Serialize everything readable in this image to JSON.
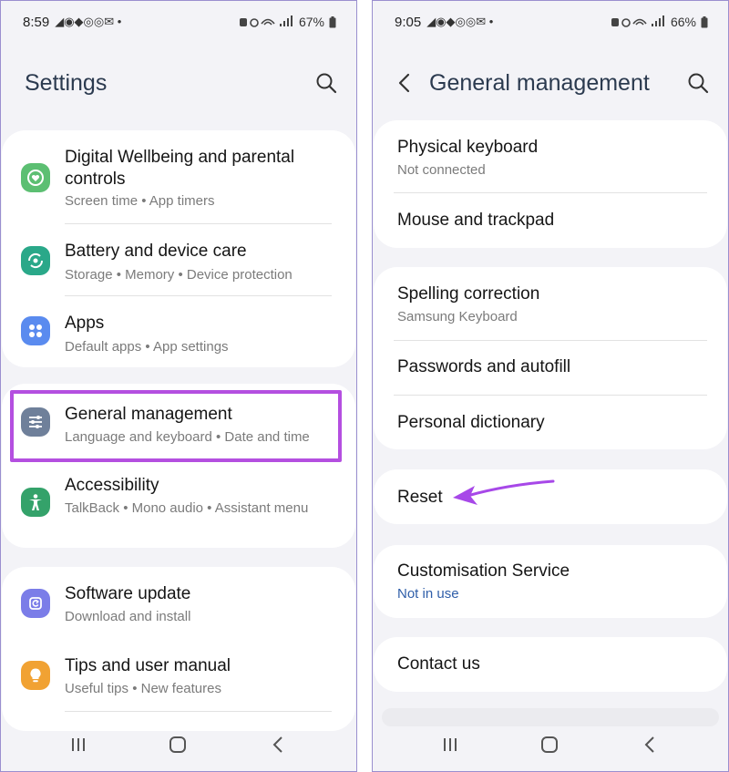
{
  "left_phone": {
    "status": {
      "time": "8:59",
      "notif_icons": "◢◉◆◎◎✉ •",
      "battery": "67%"
    },
    "header": {
      "title": "Settings"
    },
    "items": [
      {
        "title": "Digital Wellbeing and parental controls",
        "subtitle": "Screen time  •  App timers",
        "icon": "wellbeing-icon",
        "icon_color": "#5cbf72"
      },
      {
        "title": "Battery and device care",
        "subtitle": "Storage  •  Memory  •  Device protection",
        "icon": "device-care-icon",
        "icon_color": "#2aa889"
      },
      {
        "title": "Apps",
        "subtitle": "Default apps  •  App settings",
        "icon": "apps-icon",
        "icon_color": "#5a8bef"
      },
      {
        "title": "General management",
        "subtitle": "Language and keyboard  •  Date and time",
        "icon": "general-management-icon",
        "icon_color": "#6f809a"
      },
      {
        "title": "Accessibility",
        "subtitle": "TalkBack  •  Mono audio  •  Assistant menu",
        "icon": "accessibility-icon",
        "icon_color": "#34a26a"
      },
      {
        "title": "Software update",
        "subtitle": "Download and install",
        "icon": "software-update-icon",
        "icon_color": "#7b7de8"
      },
      {
        "title": "Tips and user manual",
        "subtitle": "Useful tips  •  New features",
        "icon": "tips-icon",
        "icon_color": "#f1a233"
      }
    ],
    "highlight_color": "#b44fe0"
  },
  "right_phone": {
    "status": {
      "time": "9:05",
      "notif_icons": "◢◉◆◎◎✉ •",
      "battery": "66%"
    },
    "header": {
      "title": "General management"
    },
    "items": [
      {
        "title": "Physical keyboard",
        "subtitle": "Not connected"
      },
      {
        "title": "Mouse and trackpad"
      },
      {
        "title": "Spelling correction",
        "subtitle": "Samsung Keyboard"
      },
      {
        "title": "Passwords and autofill"
      },
      {
        "title": "Personal dictionary"
      },
      {
        "title": "Reset"
      },
      {
        "title": "Customisation Service",
        "subtitle": "Not in use"
      },
      {
        "title": "Contact us"
      }
    ],
    "arrow_color": "#a748e8"
  }
}
